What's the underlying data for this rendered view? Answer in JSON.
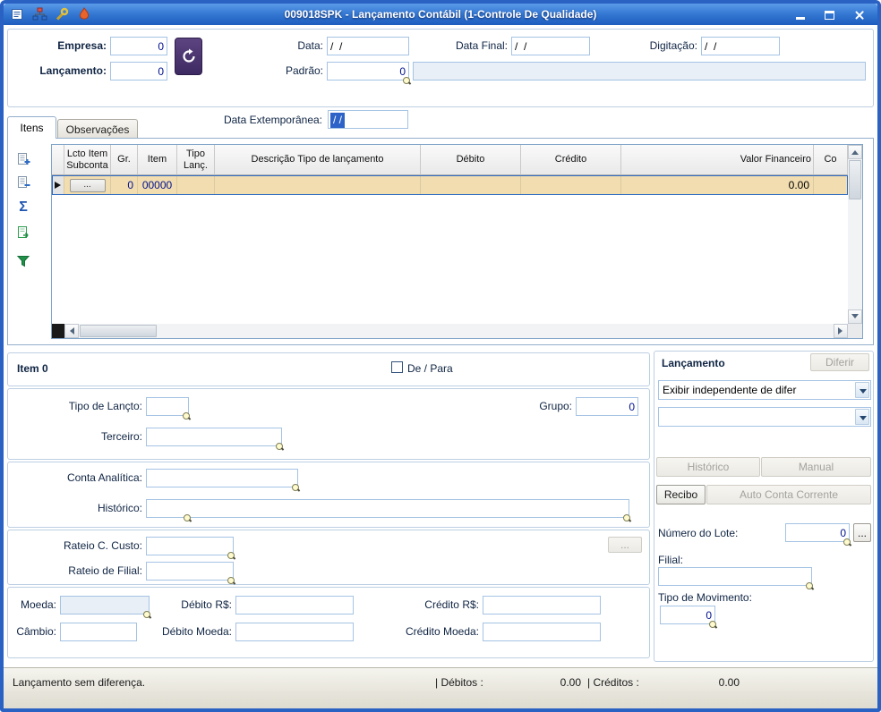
{
  "window": {
    "title": "009018SPK - Lançamento Contábil (1-Controle De Qualidade)"
  },
  "header": {
    "empresa_label": "Empresa:",
    "empresa_value": "0",
    "lancamento_label": "Lançamento:",
    "lancamento_value": "0",
    "data_label": "Data:",
    "data_value": "/  /",
    "data_final_label": "Data Final:",
    "data_final_value": "/  /",
    "digitacao_label": "Digitação:",
    "digitacao_value": "/  /",
    "padrao_label": "Padrão:",
    "padrao_value": "0",
    "padrao_descricao": "",
    "data_ext_label": "Data Extemporânea:",
    "data_ext_value": "/  /"
  },
  "tabs": {
    "itens": "Itens",
    "observacoes": "Observações"
  },
  "toolbar": {
    "sum_glyph": "Σ"
  },
  "grid": {
    "columns": [
      "Lcto Item Subconta",
      "Gr.",
      "Item",
      "Tipo Lanç.",
      "Descrição Tipo de lançamento",
      "Débito",
      "Crédito",
      "Valor Financeiro",
      "Co"
    ],
    "row": {
      "subconta_button": "...",
      "gr": "0",
      "item": "00000",
      "tipo": "",
      "descricao": "",
      "debito": "",
      "credito": "",
      "valor": "0.00",
      "co": ""
    }
  },
  "item": {
    "title": "Item 0",
    "de_para": "De / Para",
    "tipo_lancto_label": "Tipo de Lançto:",
    "tipo_lancto_value": "",
    "grupo_label": "Grupo:",
    "grupo_value": "0",
    "terceiro_label": "Terceiro:",
    "terceiro_value": "",
    "conta_analitica_label": "Conta Analítica:",
    "conta_analitica_value": "",
    "historico_label": "Histórico:",
    "historico_value": "",
    "rateio_custo_label": "Rateio C. Custo:",
    "rateio_custo_value": "",
    "rateio_custo_button": "...",
    "rateio_filial_label": "Rateio de Filial:",
    "rateio_filial_value": "",
    "moeda_label": "Moeda:",
    "moeda_value": "",
    "debito_rs_label": "Débito R$:",
    "debito_rs_value": "",
    "credito_rs_label": "Crédito R$:",
    "credito_rs_value": "",
    "cambio_label": "Câmbio:",
    "cambio_value": "",
    "debito_moeda_label": "Débito Moeda:",
    "debito_moeda_value": "",
    "credito_moeda_label": "Crédito Moeda:",
    "credito_moeda_value": ""
  },
  "lanc": {
    "title": "Lançamento",
    "diferir": "Diferir",
    "combo1": "Exibir independente de difer",
    "combo2": "",
    "historico": "Histórico",
    "manual": "Manual",
    "recibo": "Recibo",
    "auto_cc": "Auto Conta Corrente",
    "lote_label": "Número do Lote:",
    "lote_value": "0",
    "lote_button": "...",
    "filial_label": "Filial:",
    "filial_value": "",
    "tipo_mov_label": "Tipo de Movimento:",
    "tipo_mov_value": "0"
  },
  "status": {
    "message": "Lançamento sem diferença.",
    "debitos_label": "| Débitos :",
    "debitos_value": "0.00",
    "creditos_label": "| Créditos :",
    "creditos_value": "0.00"
  },
  "colors": {
    "titlebar": "#2F6FD0",
    "window_border": "#2A62C4",
    "selected_row": "#F2DDB0",
    "value_navy": "#00128F",
    "refresh_purple": "#4A2F6E",
    "filter_green": "#1F9148"
  }
}
